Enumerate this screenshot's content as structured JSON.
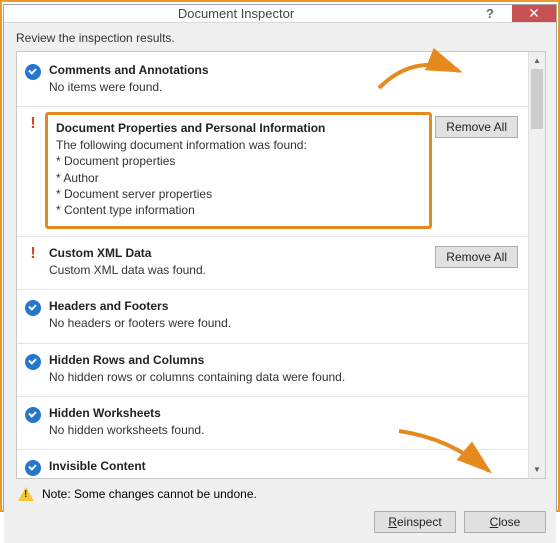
{
  "window": {
    "title": "Document Inspector",
    "help": "?",
    "close": "✕"
  },
  "review_label": "Review the inspection results.",
  "items": [
    {
      "status": "ok",
      "title": "Comments and Annotations",
      "desc": "No items were found.",
      "action": null
    },
    {
      "status": "warn",
      "title": "Document Properties and Personal Information",
      "desc": "The following document information was found:\n* Document properties\n* Author\n* Document server properties\n* Content type information",
      "action": "Remove All",
      "highlight": true
    },
    {
      "status": "warn",
      "title": "Custom XML Data",
      "desc": "Custom XML data was found.",
      "action": "Remove All"
    },
    {
      "status": "ok",
      "title": "Headers and Footers",
      "desc": "No headers or footers were found.",
      "action": null
    },
    {
      "status": "ok",
      "title": "Hidden Rows and Columns",
      "desc": "No hidden rows or columns containing data were found.",
      "action": null
    },
    {
      "status": "ok",
      "title": "Hidden Worksheets",
      "desc": "No hidden worksheets found.",
      "action": null
    },
    {
      "status": "ok",
      "title": "Invisible Content",
      "desc": "",
      "action": null,
      "cut": true
    }
  ],
  "note": "Note: Some changes cannot be undone.",
  "buttons": {
    "reinspect": "Reinspect",
    "close": "Close"
  }
}
